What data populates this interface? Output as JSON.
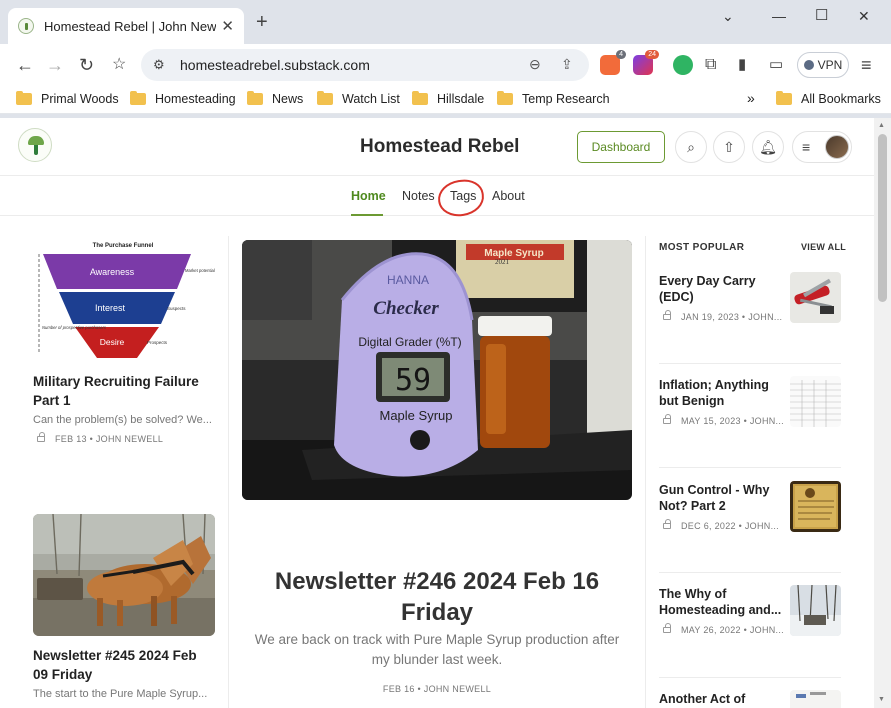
{
  "browser": {
    "tab_title": "Homestead Rebel | John Newell",
    "tab_close": "✕",
    "new_tab": "+",
    "url": "homesteadrebel.substack.com",
    "vpn_label": "VPN",
    "brave_badge": "4",
    "ext_badge": "24",
    "bookmarks": [
      "Primal Woods",
      "Homesteading",
      "News",
      "Watch List",
      "Hillsdale",
      "Temp Research"
    ],
    "bookmarks_overflow": "»",
    "all_bookmarks": "All Bookmarks"
  },
  "site": {
    "title": "Homestead Rebel",
    "dashboard_label": "Dashboard",
    "nav": [
      "Home",
      "Notes",
      "Tags",
      "About"
    ]
  },
  "funnel": {
    "heading": "The Purchase Funnel",
    "levels": [
      "Awareness",
      "Interest",
      "Desire"
    ],
    "side_labels": [
      "Market potential",
      "Suspects",
      "Prospects"
    ],
    "left_label": "Number of prospective purchasers"
  },
  "left_posts": [
    {
      "title": "Military Recruiting Failure Part 1",
      "excerpt": "Can the problem(s) be solved? We...",
      "meta": "FEB 13 • JOHN NEWELL"
    },
    {
      "title": "Newsletter #245 2024 Feb 09 Friday",
      "excerpt": "The start to the Pure Maple Syrup..."
    }
  ],
  "hero": {
    "device_brand": "HANNA",
    "device_name": "Checker",
    "device_model": "Digital Grader (%T)",
    "reading": "59",
    "device_label": "Maple Syrup",
    "background_sign": "Maple Syrup",
    "background_year": "2021",
    "title": "Newsletter #246 2024 Feb 16 Friday",
    "subtitle": "We are back on track with Pure Maple Syrup production after my blunder last week.",
    "meta": "FEB 16 • JOHN NEWELL"
  },
  "most_popular": {
    "heading": "MOST POPULAR",
    "view_all": "VIEW ALL",
    "items": [
      {
        "title": "Every Day Carry (EDC)",
        "meta": "JAN 19, 2023 • JOHN..."
      },
      {
        "title": "Inflation; Anything but Benign",
        "meta": "MAY 15, 2023 • JOHN..."
      },
      {
        "title": "Gun Control - Why Not? Part 2",
        "meta": "DEC 6, 2022 • JOHN..."
      },
      {
        "title": "The Why of Homesteading and...",
        "meta": "MAY 26, 2022 • JOHN..."
      },
      {
        "title": "Another Act of"
      }
    ]
  },
  "colors": {
    "accent": "#6c9a33",
    "annotation": "#d9342b"
  }
}
